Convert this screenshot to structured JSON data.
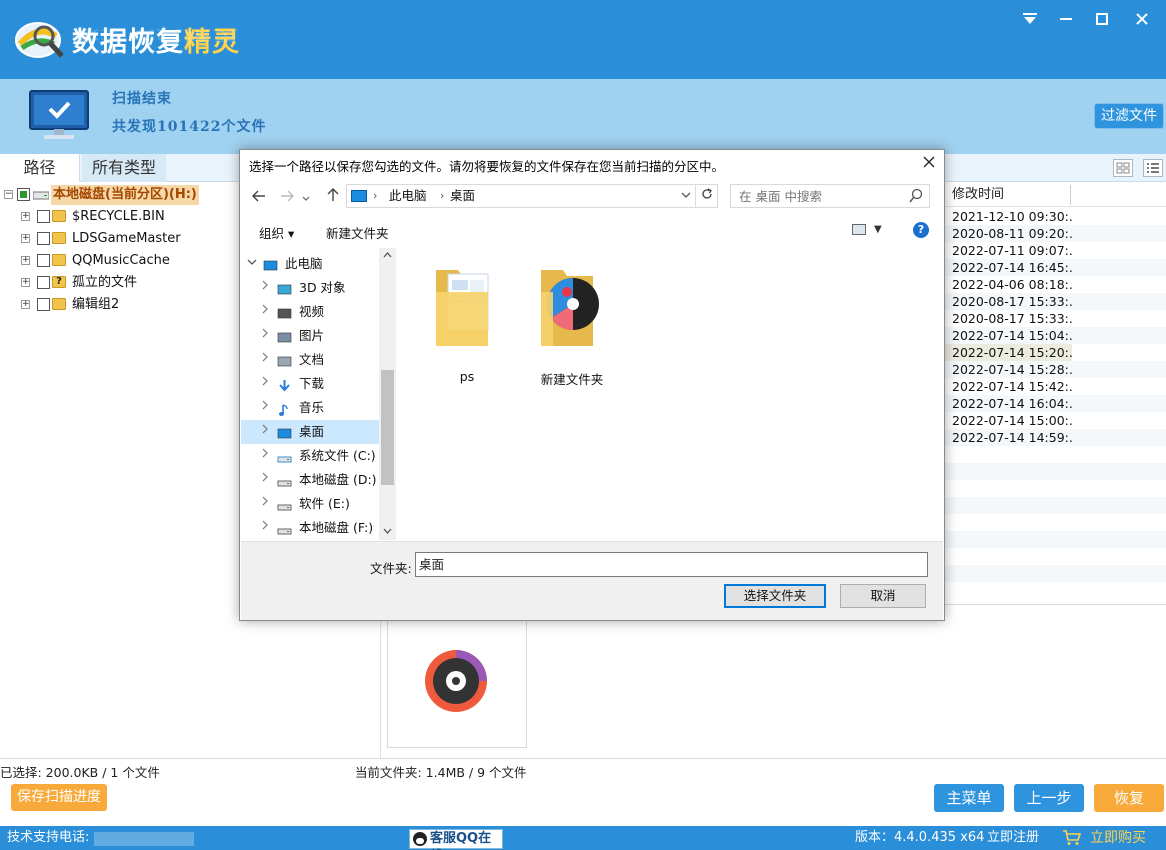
{
  "app": {
    "title_main": "数据恢复",
    "title_accent": "精灵",
    "colors": {
      "primary": "#2a8fd8",
      "accent_orange": "#f7a93a",
      "band": "#9fd2f0"
    },
    "window_icons": [
      "menu-icon",
      "minimize-icon",
      "maximize-icon",
      "close-icon"
    ]
  },
  "scan": {
    "status": "扫描结束",
    "found": "共发现101422个文件",
    "filter_button": "过滤文件"
  },
  "tabs": [
    {
      "label": "路径",
      "active": true
    },
    {
      "label": "所有类型",
      "active": false
    }
  ],
  "tree": {
    "root": "本地磁盘(当前分区)(H:)",
    "items": [
      "$RECYCLE.BIN",
      "LDSGameMaster",
      "QQMusicCache",
      "孤立的文件",
      "编辑组2"
    ]
  },
  "file_list": {
    "column_header": "修改时间",
    "times": [
      "2021-12-10 09:30:...",
      "2020-08-11 09:20:...",
      "2022-07-11 09:07:...",
      "2022-07-14 16:45:...",
      "2022-04-06 08:18:...",
      "2020-08-17 15:33:...",
      "2020-08-17 15:33:...",
      "2022-07-14 15:04:...",
      "2022-07-14 15:20:...",
      "2022-07-14 15:28:...",
      "2022-07-14 15:42:...",
      "2022-07-14 16:04:...",
      "2022-07-14 15:00:...",
      "2022-07-14 14:59:..."
    ],
    "selected_index": 8
  },
  "status": {
    "selected": "已选择: 200.0KB / 1 个文件",
    "current_folder": "当前文件夹: 1.4MB / 9 个文件"
  },
  "buttons": {
    "save_progress": "保存扫描进度",
    "main_menu": "主菜单",
    "prev_step": "上一步",
    "recover": "恢复"
  },
  "footer": {
    "support": "技术支持电话:",
    "qq_online": "客服QQ在线",
    "version": "版本：4.4.0.435 x64",
    "register": "立即注册",
    "buy": "立即购买"
  },
  "dialog": {
    "title": "选择一个路径以保存您勾选的文件。请勿将要恢复的文件保存在您当前扫描的分区中。",
    "breadcrumb": [
      "此电脑",
      "桌面"
    ],
    "search_placeholder": "在 桌面 中搜索",
    "organize": "组织 ▾",
    "new_folder": "新建文件夹",
    "help": "?",
    "nav_tree": [
      {
        "label": "此电脑",
        "icon": "pc-icon",
        "expanded": true
      },
      {
        "label": "3D 对象",
        "icon": "3d-objects-icon"
      },
      {
        "label": "视频",
        "icon": "video-icon"
      },
      {
        "label": "图片",
        "icon": "pictures-icon"
      },
      {
        "label": "文档",
        "icon": "documents-icon"
      },
      {
        "label": "下载",
        "icon": "download-icon"
      },
      {
        "label": "音乐",
        "icon": "music-icon"
      },
      {
        "label": "桌面",
        "icon": "desktop-icon",
        "selected": true
      },
      {
        "label": "系统文件 (C:)",
        "icon": "system-drive-icon"
      },
      {
        "label": "本地磁盘 (D:)",
        "icon": "drive-icon"
      },
      {
        "label": "软件 (E:)",
        "icon": "drive-icon"
      },
      {
        "label": "本地磁盘 (F:)",
        "icon": "drive-icon"
      }
    ],
    "files": [
      {
        "name": "ps"
      },
      {
        "name": "新建文件夹"
      }
    ],
    "folder_label": "文件夹:",
    "folder_value": "桌面",
    "select_button": "选择文件夹",
    "cancel_button": "取消"
  }
}
